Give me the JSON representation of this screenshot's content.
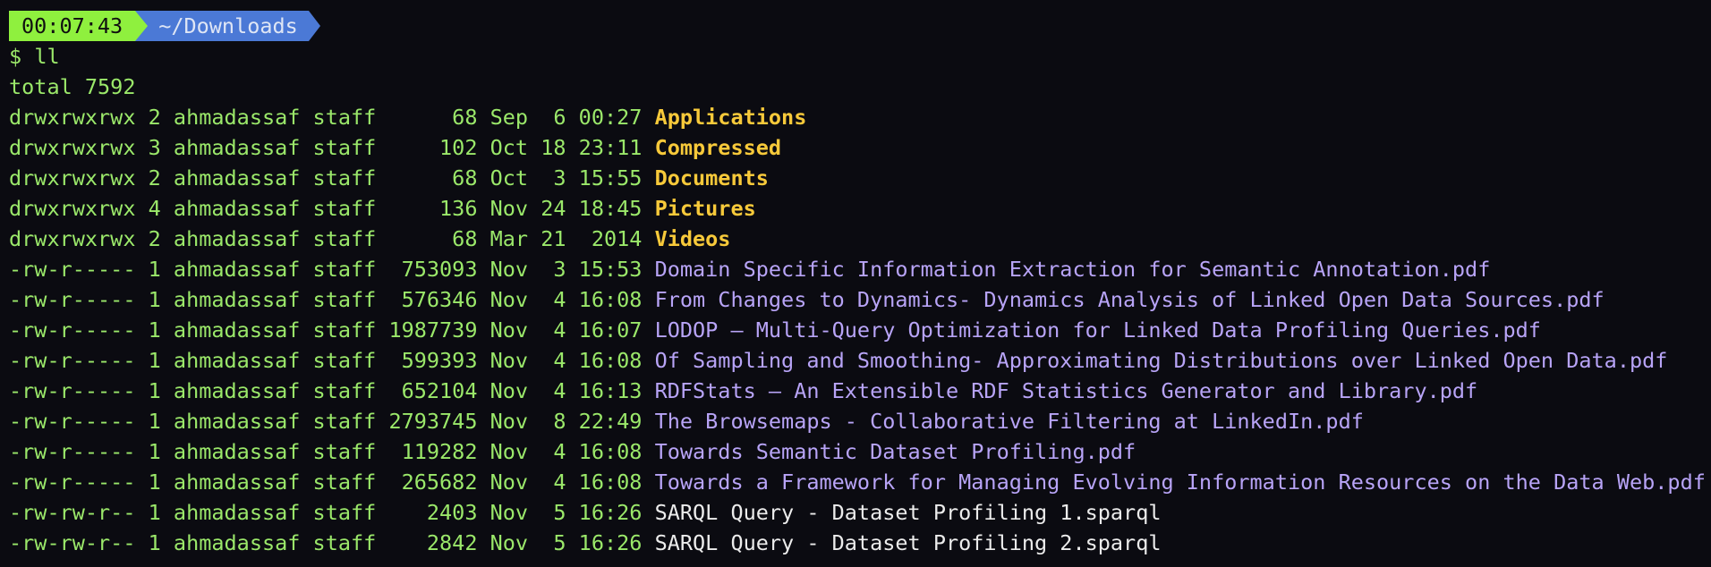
{
  "prompt": {
    "time": "00:07:43",
    "path": "~/Downloads",
    "symbol": "$",
    "command": "ll"
  },
  "total": "total 7592",
  "listing": [
    {
      "meta": "drwxrwxrwx 2 ahmadassaf staff      68 Sep  6 00:27 ",
      "name": "Applications",
      "kind": "dir"
    },
    {
      "meta": "drwxrwxrwx 3 ahmadassaf staff     102 Oct 18 23:11 ",
      "name": "Compressed",
      "kind": "dir"
    },
    {
      "meta": "drwxrwxrwx 2 ahmadassaf staff      68 Oct  3 15:55 ",
      "name": "Documents",
      "kind": "dir"
    },
    {
      "meta": "drwxrwxrwx 4 ahmadassaf staff     136 Nov 24 18:45 ",
      "name": "Pictures",
      "kind": "dir"
    },
    {
      "meta": "drwxrwxrwx 2 ahmadassaf staff      68 Mar 21  2014 ",
      "name": "Videos",
      "kind": "dir"
    },
    {
      "meta": "-rw-r----- 1 ahmadassaf staff  753093 Nov  3 15:53 ",
      "name": "Domain Specific Information Extraction for Semantic Annotation.pdf",
      "kind": "pdf"
    },
    {
      "meta": "-rw-r----- 1 ahmadassaf staff  576346 Nov  4 16:08 ",
      "name": "From Changes to Dynamics- Dynamics Analysis of Linked Open Data Sources.pdf",
      "kind": "pdf"
    },
    {
      "meta": "-rw-r----- 1 ahmadassaf staff 1987739 Nov  4 16:07 ",
      "name": "LODOP – Multi-Query Optimization for Linked Data Profiling Queries.pdf",
      "kind": "pdf"
    },
    {
      "meta": "-rw-r----- 1 ahmadassaf staff  599393 Nov  4 16:08 ",
      "name": "Of Sampling and Smoothing- Approximating Distributions over Linked Open Data.pdf",
      "kind": "pdf"
    },
    {
      "meta": "-rw-r----- 1 ahmadassaf staff  652104 Nov  4 16:13 ",
      "name": "RDFStats – An Extensible RDF Statistics Generator and Library.pdf",
      "kind": "pdf"
    },
    {
      "meta": "-rw-r----- 1 ahmadassaf staff 2793745 Nov  8 22:49 ",
      "name": "The Browsemaps - Collaborative Filtering at LinkedIn.pdf",
      "kind": "pdf"
    },
    {
      "meta": "-rw-r----- 1 ahmadassaf staff  119282 Nov  4 16:08 ",
      "name": "Towards Semantic Dataset Profiling.pdf",
      "kind": "pdf"
    },
    {
      "meta": "-rw-r----- 1 ahmadassaf staff  265682 Nov  4 16:08 ",
      "name": "Towards a Framework for Managing Evolving Information Resources on the Data Web.pdf",
      "kind": "pdf"
    },
    {
      "meta": "-rw-rw-r-- 1 ahmadassaf staff    2403 Nov  5 16:26 ",
      "name": "SARQL Query - Dataset Profiling 1.sparql",
      "kind": "other"
    },
    {
      "meta": "-rw-rw-r-- 1 ahmadassaf staff    2842 Nov  5 16:26 ",
      "name": "SARQL Query - Dataset Profiling 2.sparql",
      "kind": "other"
    }
  ],
  "colors": {
    "background": "#0b0b11",
    "meta_text": "#9be86a",
    "directory": "#f7c93a",
    "pdf_file": "#b8a4f7",
    "other_file": "#ececec",
    "time_segment": "#8ff03e",
    "path_segment": "#4b79d6"
  }
}
